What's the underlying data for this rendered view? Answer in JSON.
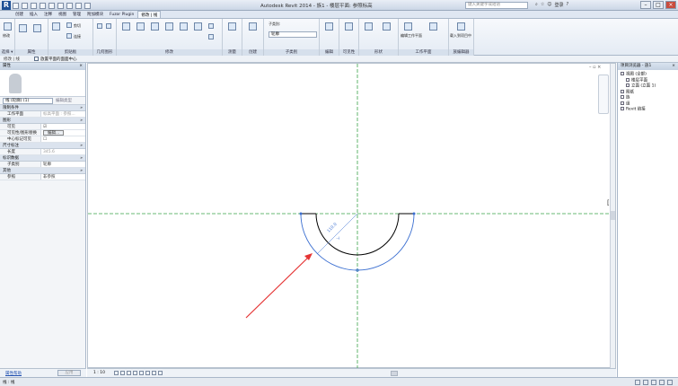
{
  "titlebar": {
    "app_title": "Autodesk Revit 2014 -",
    "document_title": "族1 - 楼层平面: 参照标高",
    "search_placeholder": "键入关键字或短语",
    "signin_label": "登录"
  },
  "tabs": [
    {
      "label": "创建"
    },
    {
      "label": "插入"
    },
    {
      "label": "注释"
    },
    {
      "label": "视图"
    },
    {
      "label": "管理"
    },
    {
      "label": "附加模块"
    },
    {
      "label": "Fuzor Plugin"
    },
    {
      "label": "修改 | 线",
      "active": true
    }
  ],
  "ribbon": {
    "panels": [
      {
        "label": "选择 ▾"
      },
      {
        "label": "属性"
      },
      {
        "label": "剪贴板"
      },
      {
        "label": "几何图形"
      },
      {
        "label": "修改"
      },
      {
        "label": "测量"
      },
      {
        "label": "创建"
      },
      {
        "label": "子类别"
      },
      {
        "label": "编辑"
      },
      {
        "label": "可见性"
      },
      {
        "label": "形状"
      },
      {
        "label": "工作平面"
      },
      {
        "label": "族编辑器"
      }
    ],
    "modify_label": "修改",
    "cut_label": "剪切",
    "join_label": "连接",
    "subcategory_label": "子类别:",
    "subcategory_value": "轮廓",
    "edit_work_plane": "编辑工作平面",
    "load_project": "载入到项目中"
  },
  "optionsbar": {
    "mode": "修改 | 线",
    "checkbox_label": "放置平面的面面中心"
  },
  "properties": {
    "title": "属性",
    "type_selector": "线 (轮廓) (1)",
    "edit_type": "编辑类型",
    "categories": [
      {
        "name": "限制条件",
        "rows": [
          {
            "key": "工作平面",
            "value": "标高平面 : 参照..."
          }
        ]
      },
      {
        "name": "图形",
        "rows": [
          {
            "key": "可见",
            "value": "☑"
          },
          {
            "key": "可见性/图形替换",
            "value": "编辑..."
          },
          {
            "key": "中心标记可见",
            "value": "☐"
          }
        ]
      },
      {
        "name": "尺寸标注",
        "rows": [
          {
            "key": "长度",
            "value": "345.6"
          }
        ]
      },
      {
        "name": "标识数据",
        "rows": [
          {
            "key": "子类别",
            "value": "轮廓"
          }
        ]
      },
      {
        "name": "其他",
        "rows": [
          {
            "key": "参照",
            "value": "非参照"
          }
        ]
      }
    ],
    "help_link": "属性帮助",
    "apply_button": "应用"
  },
  "drawing": {
    "dimension_label": "110.0",
    "colors": {
      "reference_line": "#3aa34a",
      "profile_line": "#000000",
      "selected_line": "#3b6fd1",
      "arrow": "#e53333"
    }
  },
  "viewbar": {
    "scale": "1 : 10"
  },
  "project_browser": {
    "title": "项目浏览器 - 族1",
    "items": [
      {
        "label": "视图 (全部)",
        "level": 0
      },
      {
        "label": "楼层平面",
        "level": 1
      },
      {
        "label": "立面 (立面 1)",
        "level": 1
      },
      {
        "label": "图纸",
        "level": 0
      },
      {
        "label": "族",
        "level": 0
      },
      {
        "label": "组",
        "level": 0
      },
      {
        "label": "Revit 链接",
        "level": 0
      }
    ]
  },
  "statusbar": {
    "text": "线 : 线"
  }
}
